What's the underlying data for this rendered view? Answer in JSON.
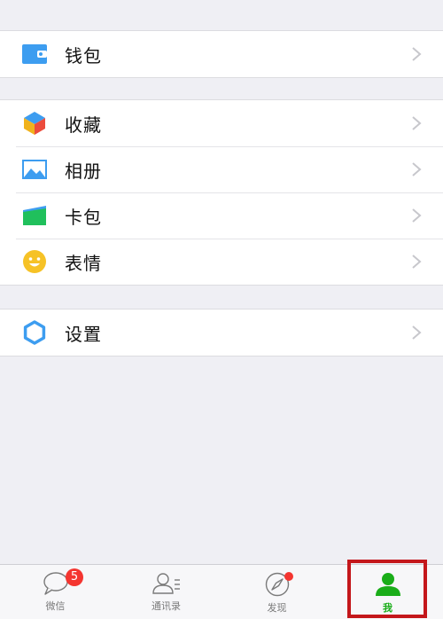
{
  "menu": {
    "wallet": {
      "label": "钱包",
      "icon": "wallet-icon"
    },
    "favorites": {
      "label": "收藏",
      "icon": "cube-icon"
    },
    "album": {
      "label": "相册",
      "icon": "image-icon"
    },
    "cards": {
      "label": "卡包",
      "icon": "card-icon"
    },
    "stickers": {
      "label": "表情",
      "icon": "smiley-icon"
    },
    "settings": {
      "label": "设置",
      "icon": "gear-icon"
    }
  },
  "tabbar": {
    "chats": {
      "label": "微信",
      "badge": "5",
      "icon": "chat-bubble-icon"
    },
    "contacts": {
      "label": "通讯录",
      "icon": "contacts-icon"
    },
    "discover": {
      "label": "发现",
      "icon": "compass-icon"
    },
    "me": {
      "label": "我",
      "icon": "person-icon"
    }
  },
  "colors": {
    "accent_green": "#1aad19",
    "badge_red": "#f43530",
    "highlight_red": "#c4171b",
    "background": "#efeff4"
  }
}
